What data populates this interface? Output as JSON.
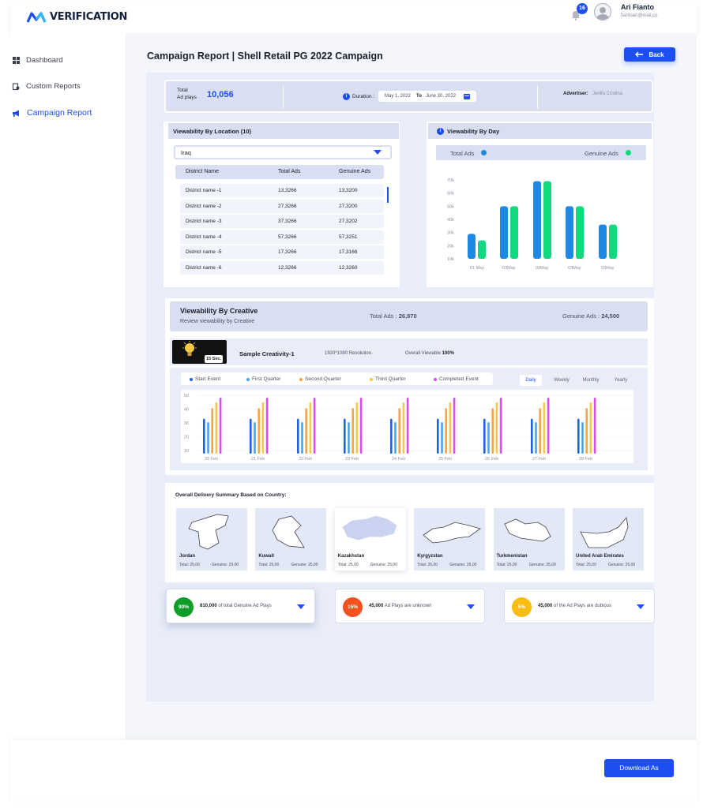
{
  "app": {
    "name": "VERIFICATION"
  },
  "header": {
    "notifications": "16",
    "user_name": "Ari Fianto",
    "user_email": "fiantoari@mail.co"
  },
  "sidebar": {
    "items": [
      {
        "label": "Dashboard",
        "icon": "grid-icon"
      },
      {
        "label": "Custom Reports",
        "icon": "report-icon"
      },
      {
        "label": "Campaign Report",
        "icon": "megaphone-icon",
        "active": true
      }
    ]
  },
  "page": {
    "title": "Campaign Report | Shell Retail PG 2022 Campaign",
    "back_label": "Back"
  },
  "summary": {
    "total_label_1": "Total",
    "total_label_2": "Ad plays",
    "total_value": "10,056",
    "duration_label": "Duration :",
    "date_from": "May 1, 2022",
    "to_label": "To",
    "date_to": "June 30, 2022",
    "advertiser_label": "Advertiser:",
    "advertiser_value": "Jenifa Cristina"
  },
  "location": {
    "title": "Viewability By Location (10)",
    "selected": "Iraq",
    "headers": [
      "District Name",
      "Total Ads",
      "Genuine Ads"
    ],
    "rows": [
      [
        "District name -1",
        "13,3266",
        "13,3200"
      ],
      [
        "District name -2",
        "27,3266",
        "27,3200"
      ],
      [
        "District name -3",
        "37,3266",
        "27,3202"
      ],
      [
        "District name -4",
        "57,3266",
        "57,3251"
      ],
      [
        "District name -5",
        "17,3266",
        "17,3166"
      ],
      [
        "District name -6",
        "12,3266",
        "12,3260"
      ]
    ]
  },
  "by_day": {
    "title": "Viewability By Day",
    "legend_total": "Total Ads",
    "legend_genuine": "Genuine Ads",
    "total_color": "#1e88e5",
    "genuine_color": "#11d97e",
    "yticks": [
      "70k",
      "60k",
      "50k",
      "40k",
      "30k",
      "20k",
      "10k"
    ]
  },
  "creative": {
    "title": "Viewability By Creative",
    "subtitle": "Review viewability by Creative",
    "total_label": "Total Ads :",
    "total_value": "26,970",
    "genuine_label": "Genuine Ads :",
    "genuine_value": "24,500",
    "thumb_badge": "15 Sec.",
    "name": "Sample Creativity-1",
    "resolution": "1920*1080 Resolution.",
    "viewable_label": "Overall Viewable",
    "viewable_value": "100%",
    "legend": [
      "Start Event",
      "First Quarter",
      "Second Quarter",
      "Third Quarter",
      "Completed Event"
    ],
    "legend_colors": [
      "#1e62e0",
      "#4aa3ef",
      "#f5a44a",
      "#f7c843",
      "#d94cf0"
    ],
    "tabs": [
      "Daily",
      "Weekly",
      "Monthly",
      "Yearly"
    ],
    "yticks": [
      "50",
      "40",
      "30",
      "20",
      "10"
    ]
  },
  "delivery": {
    "title": "Overall Delivery Summary Based on Country:",
    "countries": [
      {
        "name": "Jordan",
        "total": "Total: 25,00",
        "genuine": "Genuine: 25,00"
      },
      {
        "name": "Kuwait",
        "total": "Total: 25,00",
        "genuine": "Genuine: 25,00"
      },
      {
        "name": "Kazakhstan",
        "total": "Total: 25,00",
        "genuine": "Genuine: 25,00"
      },
      {
        "name": "Kyrgyzstan",
        "total": "Total: 25,00",
        "genuine": "Genuine: 25,00"
      },
      {
        "name": "Turkmenistan",
        "total": "Total: 25,00",
        "genuine": "Genuine: 25,00"
      },
      {
        "name": "United Arab Emirates",
        "total": "Total: 25,00",
        "genuine": "Genuine: 25,00"
      }
    ]
  },
  "stats": [
    {
      "pct": "90%",
      "value": "810,000",
      "text": "of total Genuine Ad Plays",
      "color": "#0f9d2a"
    },
    {
      "pct": "15%",
      "value": "45,000",
      "text": "Ad Plays are unknown",
      "color": "#f4511e"
    },
    {
      "pct": "5%",
      "value": "45,000",
      "text": "of the Ad Plays are dubious",
      "color": "#fbbc12"
    }
  ],
  "footer": {
    "download_label": "Download As"
  },
  "chart_data": [
    {
      "type": "bar",
      "title": "Viewability By Day",
      "categories": [
        "01 May",
        "03May",
        "03May",
        "03May",
        "03May"
      ],
      "series": [
        {
          "name": "Total Ads",
          "values": [
            29000,
            50000,
            69000,
            50000,
            36000
          ]
        },
        {
          "name": "Genuine Ads",
          "values": [
            24000,
            50000,
            69000,
            50000,
            36000
          ]
        }
      ],
      "ylim": [
        10000,
        70000
      ]
    },
    {
      "type": "bar",
      "categories": [
        "20 Feb",
        "21 Feb",
        "22 Feb",
        "23 Feb",
        "24 Feb",
        "25 Feb",
        "26 Feb",
        "27 Feb",
        "28 Feb"
      ],
      "series": [
        {
          "name": "Start Event",
          "values": [
            30,
            30,
            30,
            30,
            30,
            30,
            30,
            30,
            30
          ]
        },
        {
          "name": "First Quarter",
          "values": [
            27,
            27,
            27,
            27,
            27,
            27,
            27,
            27,
            27
          ]
        },
        {
          "name": "Second Quarter",
          "values": [
            39,
            39,
            39,
            39,
            39,
            39,
            39,
            39,
            39
          ]
        },
        {
          "name": "Third Quarter",
          "values": [
            44,
            44,
            44,
            44,
            44,
            44,
            44,
            44,
            44
          ]
        },
        {
          "name": "Completed Event",
          "values": [
            48,
            48,
            48,
            48,
            48,
            48,
            48,
            48,
            48
          ]
        }
      ],
      "ylim": [
        10,
        50
      ]
    }
  ]
}
